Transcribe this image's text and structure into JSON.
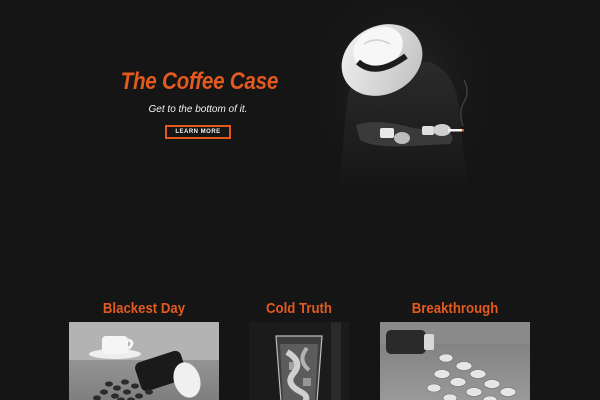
{
  "hero": {
    "title": "The Coffee Case",
    "subtitle": "Get to the bottom of it.",
    "button_label": "LEARN MORE"
  },
  "features": [
    {
      "title": "Blackest Day",
      "image": "coffee-cup-and-spilled-beans-photo"
    },
    {
      "title": "Cold Truth",
      "image": "iced-coffee-glass-photo"
    },
    {
      "title": "Breakthrough",
      "image": "spilled-pills-bottle-photo"
    }
  ],
  "colors": {
    "background": "#151515",
    "accent": "#e35a1f",
    "text": "#f2f2f2"
  }
}
